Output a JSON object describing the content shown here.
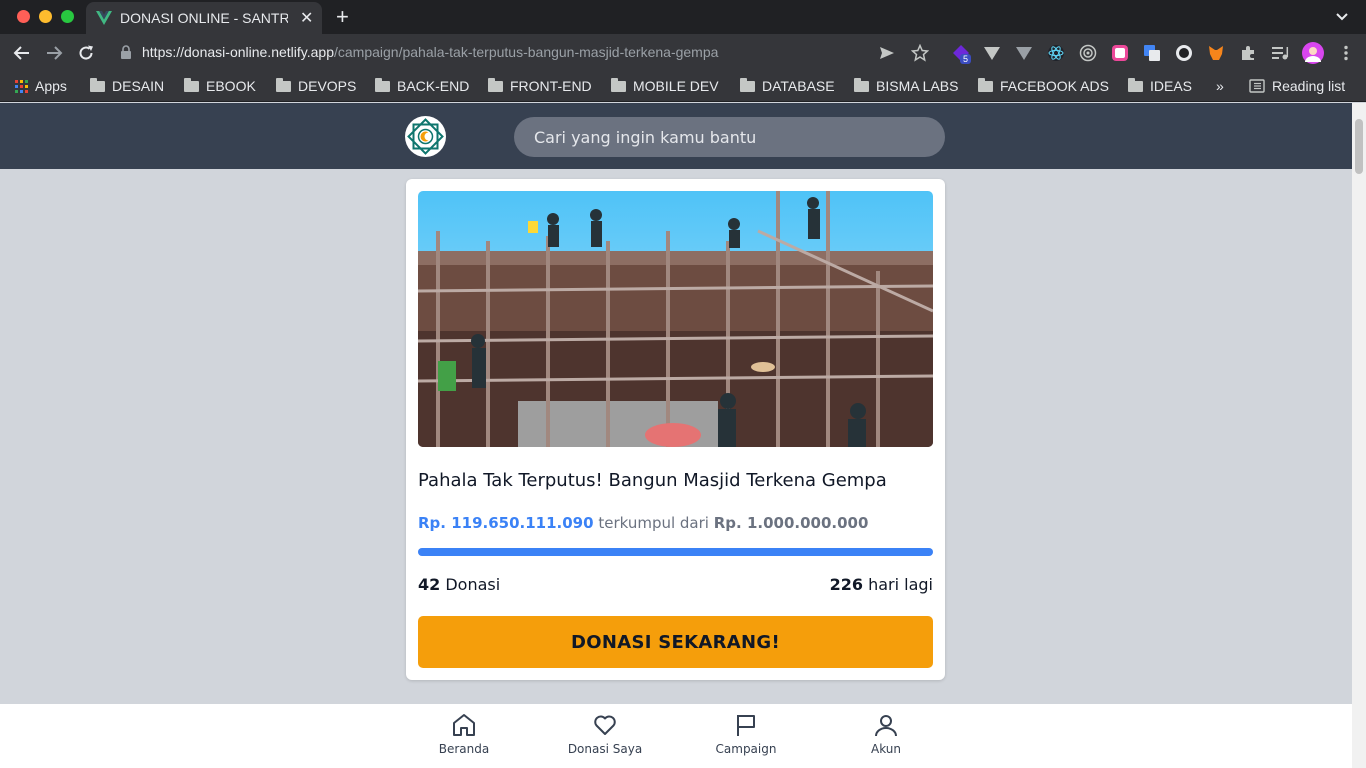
{
  "browser": {
    "tab_title": "DONASI ONLINE - SANTRI",
    "url_host": "https://donasi-online.netlify.app",
    "url_path": "/campaign/pahala-tak-terputus-bangun-masjid-terkena-gempa",
    "extension_badge": "5",
    "bookmarks": [
      "Apps",
      "DESAIN",
      "EBOOK",
      "DEVOPS",
      "BACK-END",
      "FRONT-END",
      "MOBILE DEV",
      "DATABASE",
      "BISMA LABS",
      "FACEBOOK ADS",
      "IDEAS"
    ],
    "more_bookmarks": "»",
    "reading_list": "Reading list"
  },
  "header": {
    "search_placeholder": "Cari yang ingin kamu bantu"
  },
  "campaign": {
    "title": "Pahala Tak Terputus! Bangun Masjid Terkena Gempa",
    "collected": "Rp. 119.650.111.090",
    "collected_text": "terkumpul dari",
    "target": "Rp. 1.000.000.000",
    "progress_percent": 100,
    "donation_count": "42",
    "donation_label": "Donasi",
    "days_left": "226",
    "days_label": "hari lagi",
    "cta": "DONASI SEKARANG!"
  },
  "nav": {
    "items": [
      {
        "label": "Beranda",
        "icon": "home-icon"
      },
      {
        "label": "Donasi Saya",
        "icon": "heart-icon"
      },
      {
        "label": "Campaign",
        "icon": "flag-icon"
      },
      {
        "label": "Akun",
        "icon": "user-icon"
      }
    ]
  },
  "colors": {
    "header_bg": "#374151",
    "accent_blue": "#3b82f6",
    "cta_orange": "#f59e0b"
  }
}
